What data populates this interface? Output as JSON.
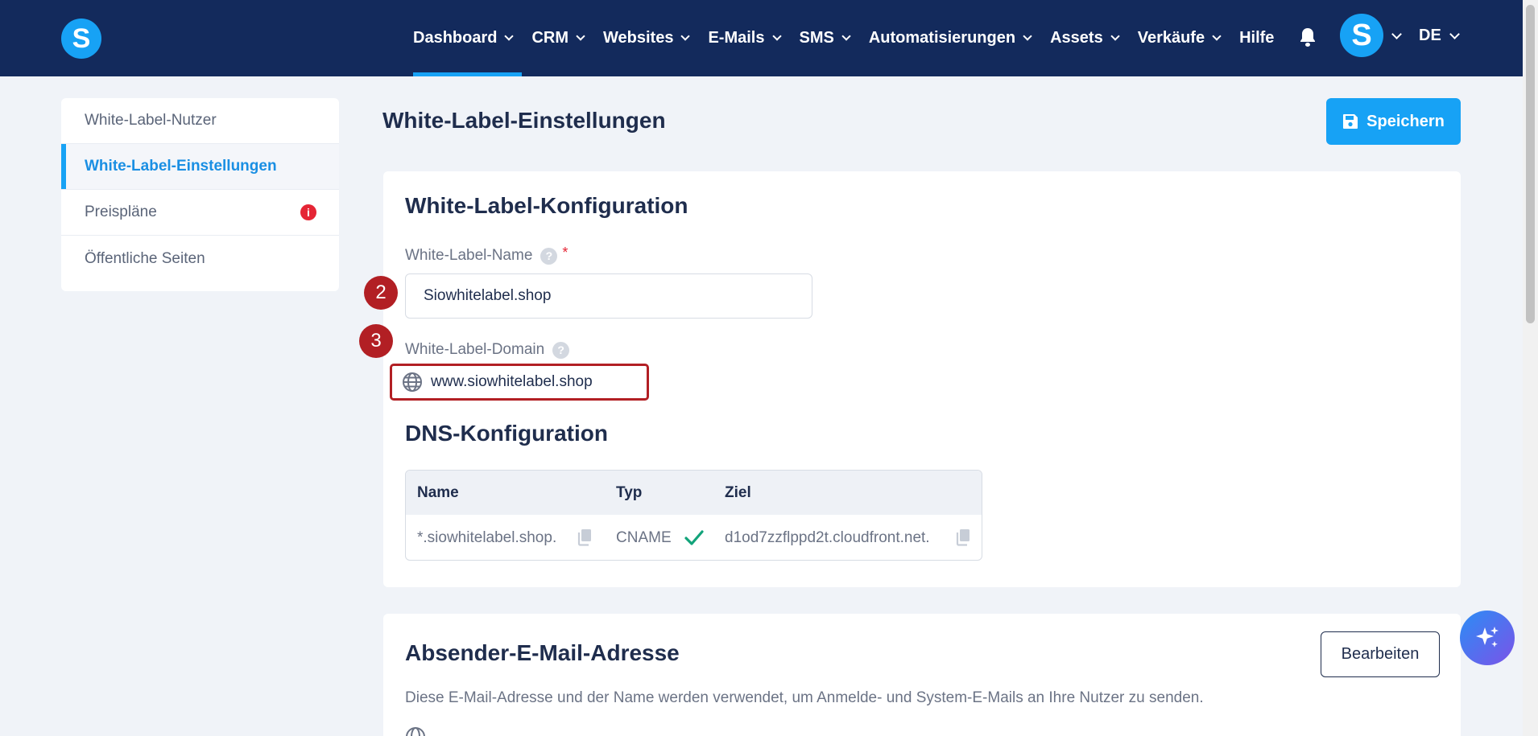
{
  "nav": {
    "logo_letter": "S",
    "items": [
      {
        "label": "Dashboard",
        "dropdown": true,
        "active": true
      },
      {
        "label": "CRM",
        "dropdown": true
      },
      {
        "label": "Websites",
        "dropdown": true
      },
      {
        "label": "E-Mails",
        "dropdown": true
      },
      {
        "label": "SMS",
        "dropdown": true
      },
      {
        "label": "Automatisierungen",
        "dropdown": true
      },
      {
        "label": "Assets",
        "dropdown": true
      },
      {
        "label": "Verkäufe",
        "dropdown": true
      },
      {
        "label": "Hilfe",
        "dropdown": false
      }
    ],
    "avatar_letter": "S",
    "language": "DE"
  },
  "sidebar": {
    "items": [
      {
        "label": "White-Label-Nutzer"
      },
      {
        "label": "White-Label-Einstellungen",
        "active": true
      },
      {
        "label": "Preispläne",
        "badge": "i"
      },
      {
        "label": "Öffentliche Seiten"
      }
    ]
  },
  "page": {
    "title": "White-Label-Einstellungen",
    "save_label": "Speichern"
  },
  "config": {
    "title": "White-Label-Konfiguration",
    "name_label": "White-Label-Name",
    "help_glyph": "?",
    "required_mark": "*",
    "name_value": "Siowhitelabel.shop",
    "domain_label": "White-Label-Domain",
    "domain_value": "www.siowhitelabel.shop",
    "dns_title": "DNS-Konfiguration",
    "dns_headers": {
      "name": "Name",
      "type": "Typ",
      "target": "Ziel"
    },
    "dns_row": {
      "name": "*.siowhitelabel.shop.",
      "type": "CNAME",
      "target": "d1od7zzflppd2t.cloudfront.net."
    }
  },
  "steps": {
    "two": "2",
    "three": "3"
  },
  "sender": {
    "title": "Absender-E-Mail-Adresse",
    "edit_label": "Bearbeiten",
    "description": "Diese E-Mail-Adresse und der Name werden verwendet, um Anmelde- und System-E-Mails an Ihre Nutzer zu senden."
  },
  "colors": {
    "nav_bg": "#132a5c",
    "accent": "#17a2f5",
    "step_red": "#b21f24",
    "check_green": "#12a37a"
  }
}
